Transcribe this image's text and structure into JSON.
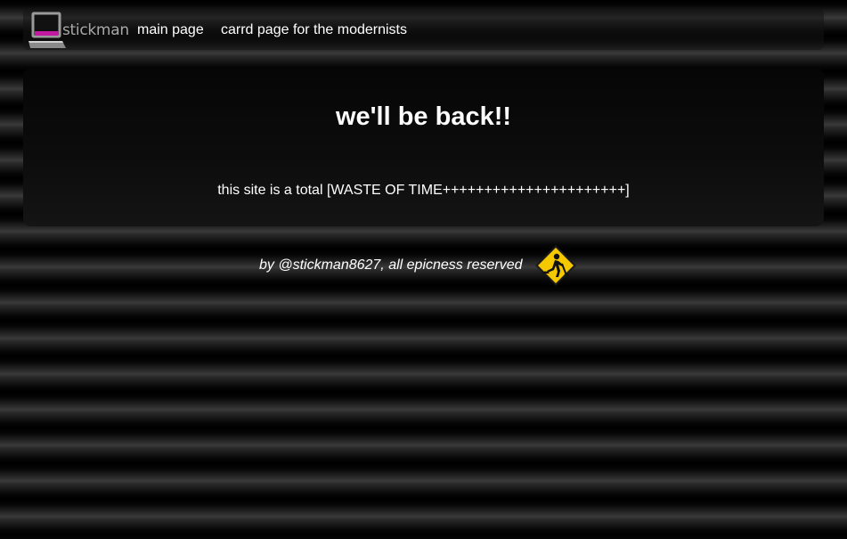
{
  "nav": {
    "logo_text": "stickman",
    "links": [
      "main page",
      "carrd page for the modernists"
    ]
  },
  "card": {
    "title": "we'll be back!!",
    "text": "this site is a total [WASTE OF TIME++++++++++++++++++++++]"
  },
  "footer": {
    "text": "by @stickman8627, all epicness reserved"
  },
  "icons": {
    "logo": "laptop-icon",
    "footer": "under-construction-sign-icon"
  },
  "colors": {
    "text": "#ffffff",
    "logo_text": "#a8a8a8",
    "card_background": "#0c0c0c",
    "sign_yellow": "#f5c800",
    "logo_accent": "#c21aa0"
  }
}
